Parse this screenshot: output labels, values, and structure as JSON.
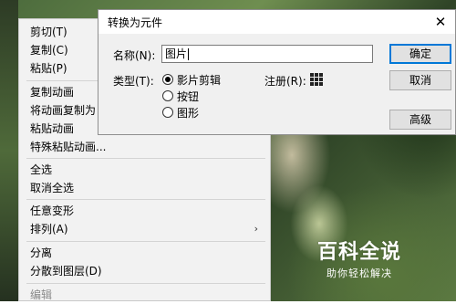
{
  "context_menu": {
    "items": [
      {
        "label": "剪切(T)",
        "disabled": false
      },
      {
        "label": "复制(C)",
        "disabled": false
      },
      {
        "label": "粘贴(P)",
        "disabled": false
      },
      {
        "label": "复制动画",
        "disabled": false
      },
      {
        "label": "将动画复制为",
        "disabled": false
      },
      {
        "label": "粘贴动画",
        "disabled": false
      },
      {
        "label": "特殊粘贴动画...",
        "disabled": false
      },
      {
        "label": "全选",
        "disabled": false
      },
      {
        "label": "取消全选",
        "disabled": false
      },
      {
        "label": "任意变形",
        "disabled": false
      },
      {
        "label": "排列(A)",
        "disabled": false,
        "submenu_arrow": "›"
      },
      {
        "label": "分离",
        "disabled": false
      },
      {
        "label": "分散到图层(D)",
        "disabled": false
      },
      {
        "label": "编辑",
        "disabled": true
      }
    ]
  },
  "dialog": {
    "title": "转换为元件",
    "close_glyph": "✕",
    "name_label": "名称(N):",
    "name_value": "图片",
    "type_label": "类型(T):",
    "type_options": [
      "影片剪辑",
      "按钮",
      "图形"
    ],
    "selected_type": "影片剪辑",
    "registration_label": "注册(R):",
    "buttons": {
      "ok": "确定",
      "cancel": "取消",
      "advanced": "高级"
    }
  },
  "watermark": {
    "logo_text": "百科全说",
    "sub_text": "助你轻松解决"
  }
}
